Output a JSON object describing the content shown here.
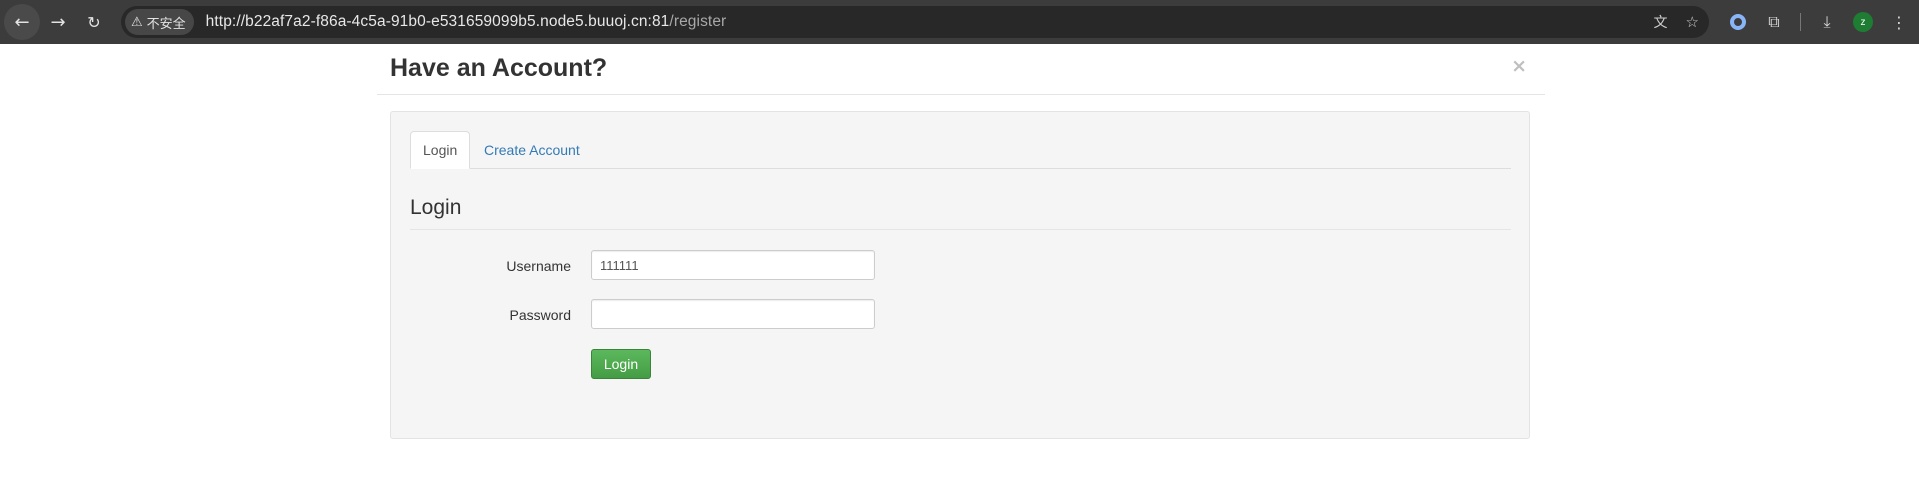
{
  "browser": {
    "security_label": "不安全",
    "url_host": "http://b22af7a2-f86a-4c5a-91b0-e531659099b5.node5.buuoj.cn:81",
    "url_path": "/register",
    "profile_initial": "z"
  },
  "icons": {
    "back": "arrow-left-icon",
    "forward": "arrow-right-icon",
    "reload": "reload-icon",
    "warning": "warning-triangle-icon",
    "translate": "translate-icon",
    "bookmark": "star-icon",
    "extension_ring": "ring-icon",
    "extensions": "puzzle-icon",
    "download": "download-icon",
    "menu": "more-vertical-icon",
    "close": "close-icon"
  },
  "modal": {
    "title": "Have an Account?",
    "close_label": "×"
  },
  "tabs": [
    {
      "label": "Login",
      "active": true
    },
    {
      "label": "Create Account",
      "active": false
    }
  ],
  "form": {
    "legend": "Login",
    "username_label": "Username",
    "username_value": "111111",
    "password_label": "Password",
    "password_value": "",
    "submit_label": "Login"
  },
  "colors": {
    "chrome_bg": "#3c3c3c",
    "link": "#337ab7",
    "success_button": "#5cb85c",
    "panel_bg": "#f5f5f5"
  }
}
